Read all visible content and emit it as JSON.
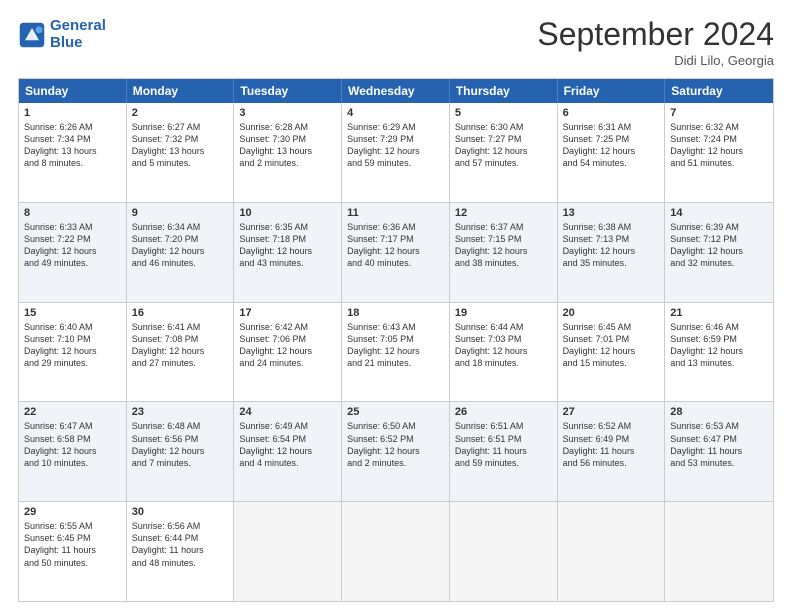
{
  "header": {
    "logo_line1": "General",
    "logo_line2": "Blue",
    "month": "September 2024",
    "location": "Didi Lilo, Georgia"
  },
  "days_of_week": [
    "Sunday",
    "Monday",
    "Tuesday",
    "Wednesday",
    "Thursday",
    "Friday",
    "Saturday"
  ],
  "weeks": [
    [
      {
        "day": "1",
        "text": "Sunrise: 6:26 AM\nSunset: 7:34 PM\nDaylight: 13 hours\nand 8 minutes.",
        "shaded": false
      },
      {
        "day": "2",
        "text": "Sunrise: 6:27 AM\nSunset: 7:32 PM\nDaylight: 13 hours\nand 5 minutes.",
        "shaded": false
      },
      {
        "day": "3",
        "text": "Sunrise: 6:28 AM\nSunset: 7:30 PM\nDaylight: 13 hours\nand 2 minutes.",
        "shaded": false
      },
      {
        "day": "4",
        "text": "Sunrise: 6:29 AM\nSunset: 7:29 PM\nDaylight: 12 hours\nand 59 minutes.",
        "shaded": false
      },
      {
        "day": "5",
        "text": "Sunrise: 6:30 AM\nSunset: 7:27 PM\nDaylight: 12 hours\nand 57 minutes.",
        "shaded": false
      },
      {
        "day": "6",
        "text": "Sunrise: 6:31 AM\nSunset: 7:25 PM\nDaylight: 12 hours\nand 54 minutes.",
        "shaded": false
      },
      {
        "day": "7",
        "text": "Sunrise: 6:32 AM\nSunset: 7:24 PM\nDaylight: 12 hours\nand 51 minutes.",
        "shaded": false
      }
    ],
    [
      {
        "day": "8",
        "text": "Sunrise: 6:33 AM\nSunset: 7:22 PM\nDaylight: 12 hours\nand 49 minutes.",
        "shaded": true
      },
      {
        "day": "9",
        "text": "Sunrise: 6:34 AM\nSunset: 7:20 PM\nDaylight: 12 hours\nand 46 minutes.",
        "shaded": true
      },
      {
        "day": "10",
        "text": "Sunrise: 6:35 AM\nSunset: 7:18 PM\nDaylight: 12 hours\nand 43 minutes.",
        "shaded": true
      },
      {
        "day": "11",
        "text": "Sunrise: 6:36 AM\nSunset: 7:17 PM\nDaylight: 12 hours\nand 40 minutes.",
        "shaded": true
      },
      {
        "day": "12",
        "text": "Sunrise: 6:37 AM\nSunset: 7:15 PM\nDaylight: 12 hours\nand 38 minutes.",
        "shaded": true
      },
      {
        "day": "13",
        "text": "Sunrise: 6:38 AM\nSunset: 7:13 PM\nDaylight: 12 hours\nand 35 minutes.",
        "shaded": true
      },
      {
        "day": "14",
        "text": "Sunrise: 6:39 AM\nSunset: 7:12 PM\nDaylight: 12 hours\nand 32 minutes.",
        "shaded": true
      }
    ],
    [
      {
        "day": "15",
        "text": "Sunrise: 6:40 AM\nSunset: 7:10 PM\nDaylight: 12 hours\nand 29 minutes.",
        "shaded": false
      },
      {
        "day": "16",
        "text": "Sunrise: 6:41 AM\nSunset: 7:08 PM\nDaylight: 12 hours\nand 27 minutes.",
        "shaded": false
      },
      {
        "day": "17",
        "text": "Sunrise: 6:42 AM\nSunset: 7:06 PM\nDaylight: 12 hours\nand 24 minutes.",
        "shaded": false
      },
      {
        "day": "18",
        "text": "Sunrise: 6:43 AM\nSunset: 7:05 PM\nDaylight: 12 hours\nand 21 minutes.",
        "shaded": false
      },
      {
        "day": "19",
        "text": "Sunrise: 6:44 AM\nSunset: 7:03 PM\nDaylight: 12 hours\nand 18 minutes.",
        "shaded": false
      },
      {
        "day": "20",
        "text": "Sunrise: 6:45 AM\nSunset: 7:01 PM\nDaylight: 12 hours\nand 15 minutes.",
        "shaded": false
      },
      {
        "day": "21",
        "text": "Sunrise: 6:46 AM\nSunset: 6:59 PM\nDaylight: 12 hours\nand 13 minutes.",
        "shaded": false
      }
    ],
    [
      {
        "day": "22",
        "text": "Sunrise: 6:47 AM\nSunset: 6:58 PM\nDaylight: 12 hours\nand 10 minutes.",
        "shaded": true
      },
      {
        "day": "23",
        "text": "Sunrise: 6:48 AM\nSunset: 6:56 PM\nDaylight: 12 hours\nand 7 minutes.",
        "shaded": true
      },
      {
        "day": "24",
        "text": "Sunrise: 6:49 AM\nSunset: 6:54 PM\nDaylight: 12 hours\nand 4 minutes.",
        "shaded": true
      },
      {
        "day": "25",
        "text": "Sunrise: 6:50 AM\nSunset: 6:52 PM\nDaylight: 12 hours\nand 2 minutes.",
        "shaded": true
      },
      {
        "day": "26",
        "text": "Sunrise: 6:51 AM\nSunset: 6:51 PM\nDaylight: 11 hours\nand 59 minutes.",
        "shaded": true
      },
      {
        "day": "27",
        "text": "Sunrise: 6:52 AM\nSunset: 6:49 PM\nDaylight: 11 hours\nand 56 minutes.",
        "shaded": true
      },
      {
        "day": "28",
        "text": "Sunrise: 6:53 AM\nSunset: 6:47 PM\nDaylight: 11 hours\nand 53 minutes.",
        "shaded": true
      }
    ],
    [
      {
        "day": "29",
        "text": "Sunrise: 6:55 AM\nSunset: 6:45 PM\nDaylight: 11 hours\nand 50 minutes.",
        "shaded": false
      },
      {
        "day": "30",
        "text": "Sunrise: 6:56 AM\nSunset: 6:44 PM\nDaylight: 11 hours\nand 48 minutes.",
        "shaded": false
      },
      {
        "day": "",
        "text": "",
        "shaded": false,
        "empty": true
      },
      {
        "day": "",
        "text": "",
        "shaded": false,
        "empty": true
      },
      {
        "day": "",
        "text": "",
        "shaded": false,
        "empty": true
      },
      {
        "day": "",
        "text": "",
        "shaded": false,
        "empty": true
      },
      {
        "day": "",
        "text": "",
        "shaded": false,
        "empty": true
      }
    ]
  ]
}
